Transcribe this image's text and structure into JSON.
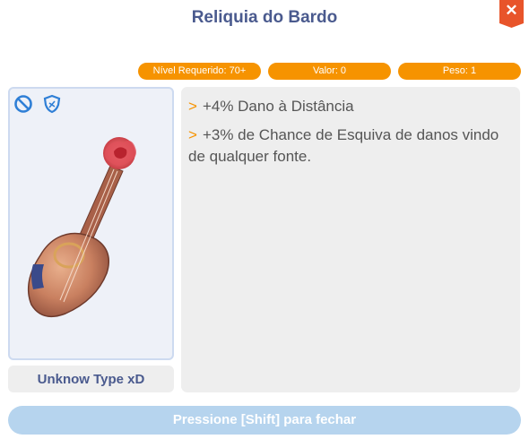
{
  "window": {
    "title": "Reliquia do Bardo",
    "close_label": "✕"
  },
  "stats": {
    "level_required": "Nível Requerido: 70+",
    "value": "Valor: 0",
    "weight": "Peso: 1"
  },
  "item": {
    "icons": [
      "forbidden-icon",
      "shield-icon"
    ],
    "type_label": "Unknow Type xD"
  },
  "description": [
    {
      "marker": ">",
      "text": "+4% Dano à Distância"
    },
    {
      "marker": ">",
      "text": "+3% de Chance de Esquiva de danos vindo de qualquer fonte."
    }
  ],
  "footer": {
    "close_hint": "Pressione [Shift] para fechar"
  },
  "colors": {
    "accent": "#f69300",
    "title": "#4a5a8e",
    "close": "#e8542a",
    "footer": "#b6d4ee"
  }
}
